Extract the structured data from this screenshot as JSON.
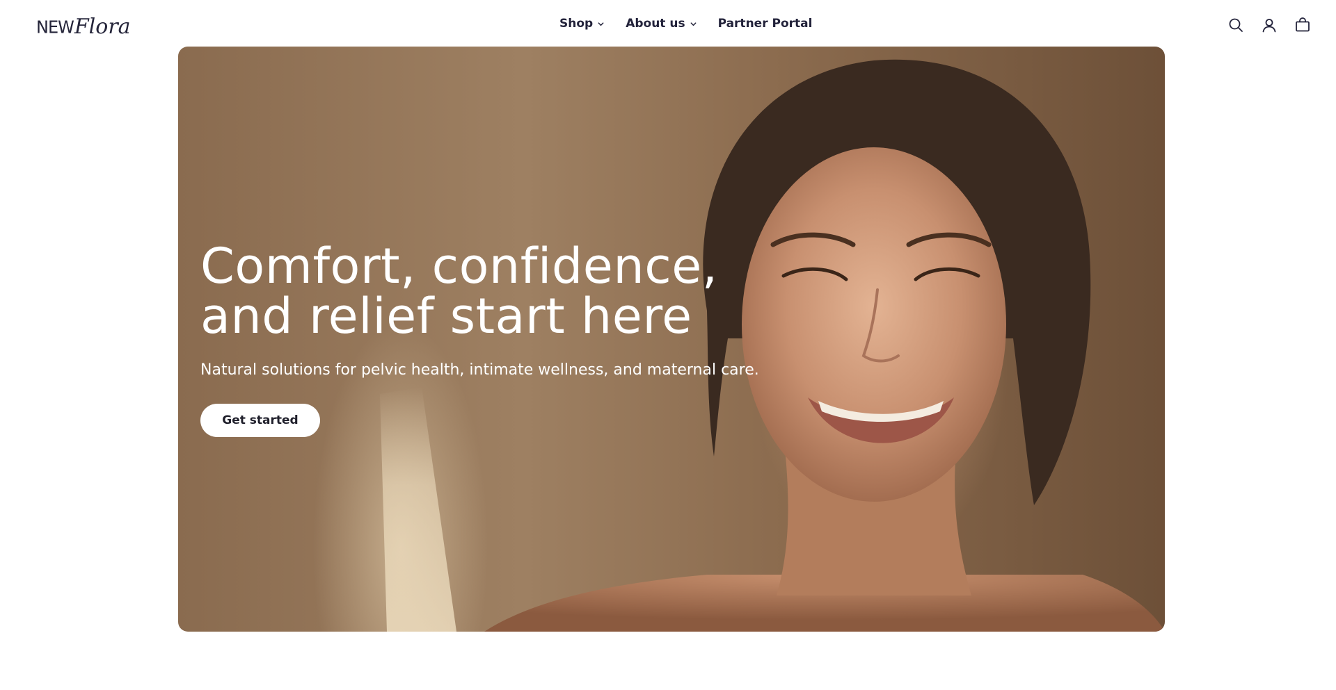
{
  "brand": {
    "logo_text_1": "NEW",
    "logo_text_2": "Flora"
  },
  "nav": {
    "items": [
      {
        "label": "Shop",
        "has_dropdown": true
      },
      {
        "label": "About us",
        "has_dropdown": true
      },
      {
        "label": "Partner Portal",
        "has_dropdown": false
      }
    ]
  },
  "header_icons": [
    "search-icon",
    "account-icon",
    "cart-icon"
  ],
  "hero": {
    "title_line_1": "Comfort, confidence,",
    "title_line_2": "and relief start here",
    "subtitle": "Natural solutions for pelvic health, intimate wellness, and maternal care.",
    "cta_label": "Get started"
  },
  "colors": {
    "text_dark": "#22223a",
    "hero_bg": "#9e8062",
    "button_bg": "#ffffff"
  }
}
